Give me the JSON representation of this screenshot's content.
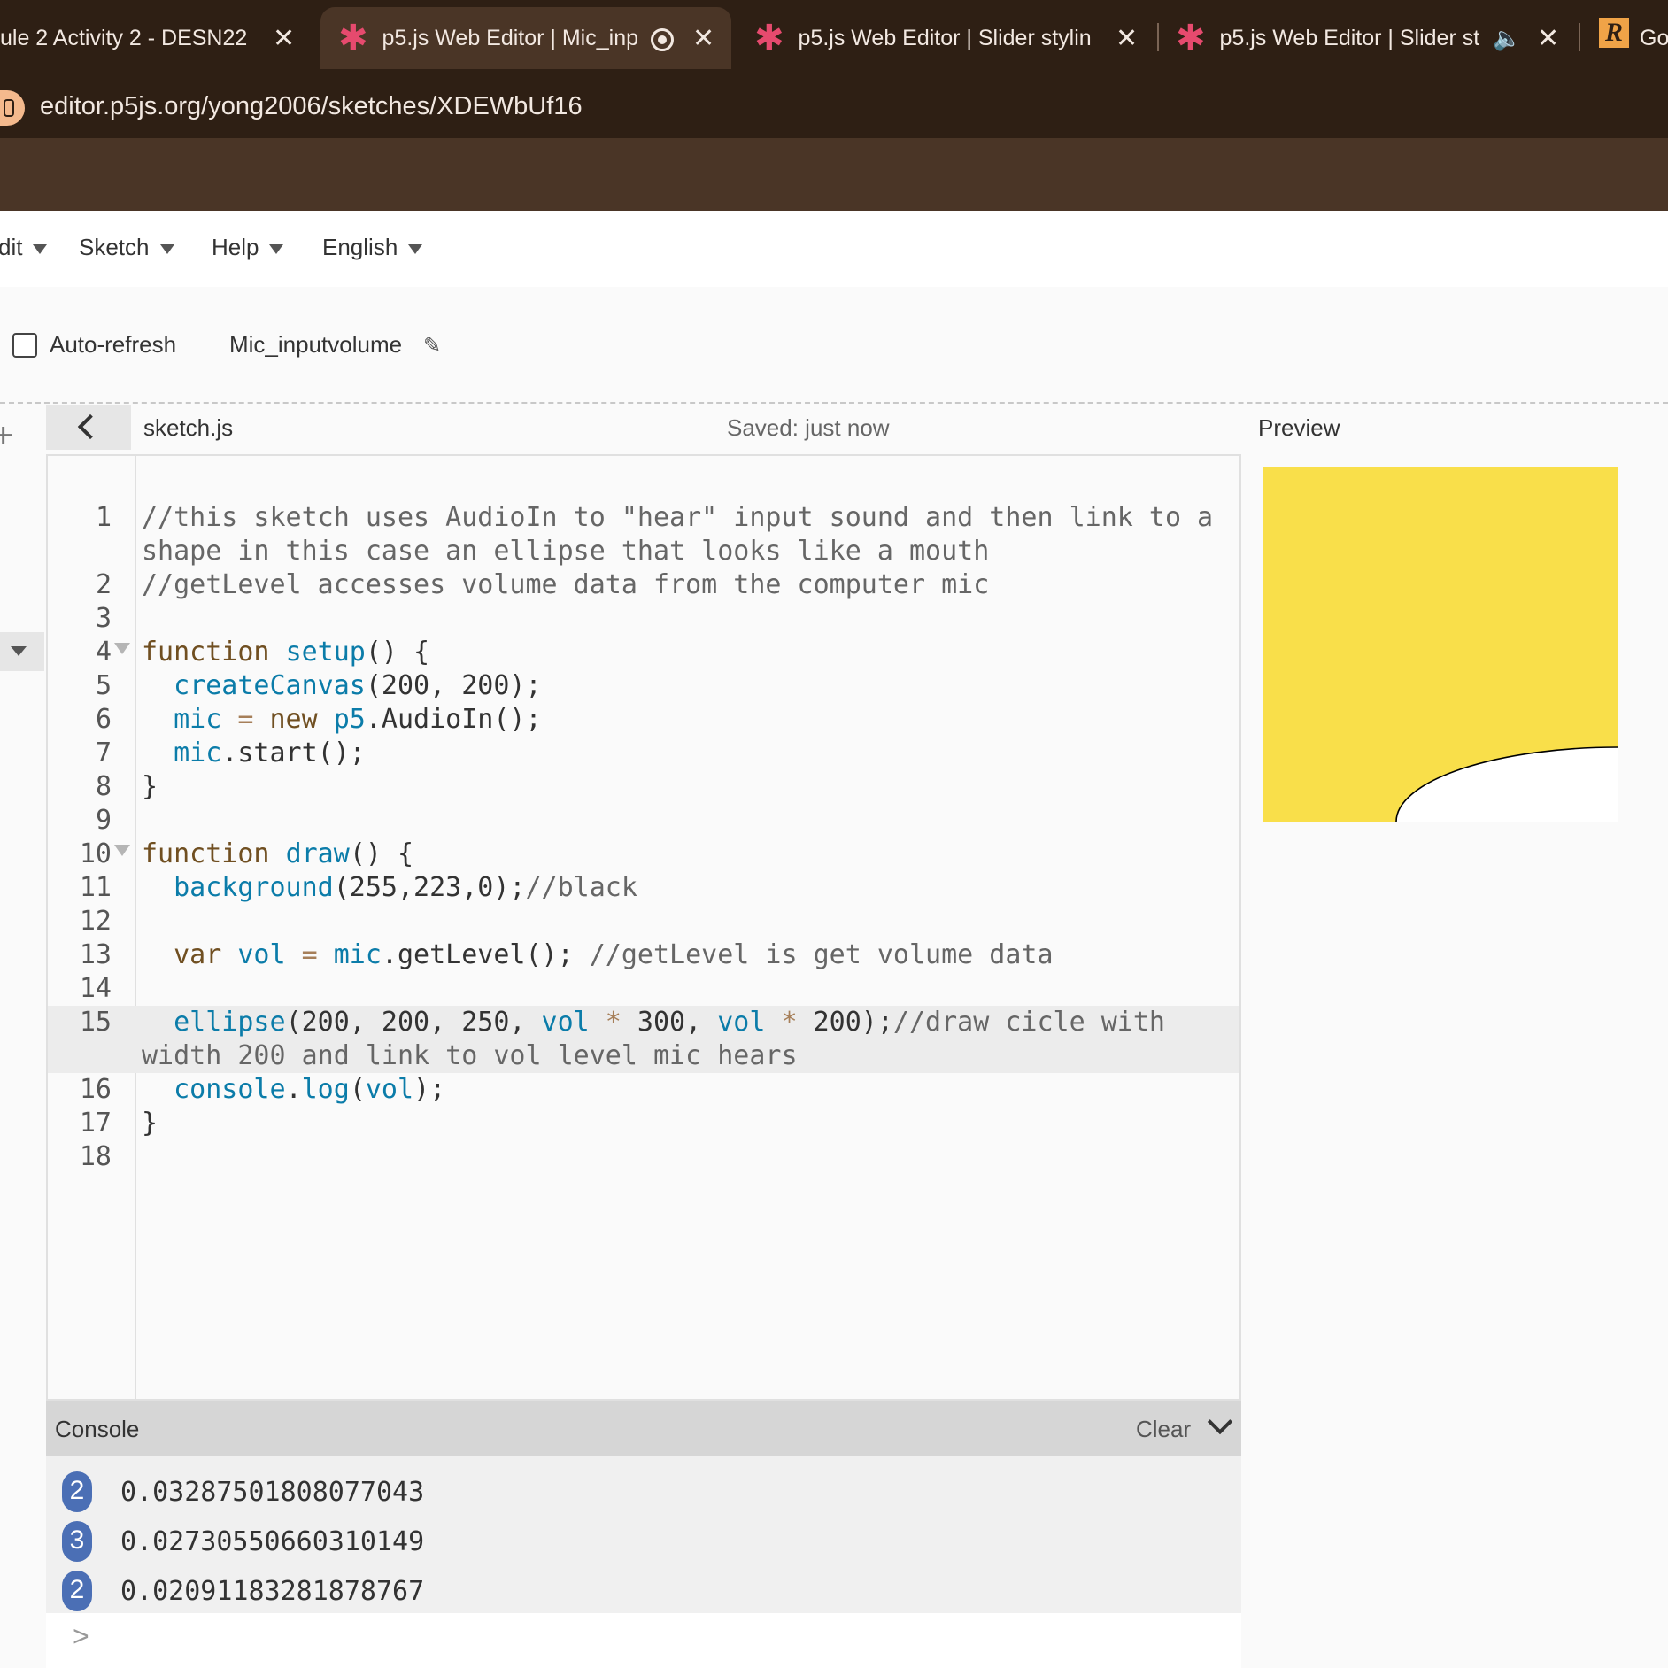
{
  "browser": {
    "tabs": [
      {
        "title": "ule 2 Activity 2 - DESN22"
      },
      {
        "title": "p5.js Web Editor | Mic_inp"
      },
      {
        "title": "p5.js Web Editor | Slider stylin"
      },
      {
        "title": "p5.js Web Editor | Slider st"
      },
      {
        "title": "Go"
      }
    ],
    "url": "editor.p5js.org/yong2006/sketches/XDEWbUf16"
  },
  "menu": {
    "items": [
      "dit",
      "Sketch",
      "Help",
      "English"
    ]
  },
  "toolbar": {
    "auto_refresh_label": "Auto-refresh",
    "auto_refresh_checked": false,
    "sketch_name": "Mic_inputvolume"
  },
  "editor": {
    "filename": "sketch.js",
    "save_status": "Saved: just now",
    "preview_label": "Preview",
    "highlighted_line": 15,
    "lines": [
      {
        "n": "1",
        "text": "//this sketch uses AudioIn to \"hear\" input sound and then link to a shape in this case an ellipse that looks like a mouth"
      },
      {
        "n": "2",
        "text": "//getLevel accesses volume data from the computer mic"
      },
      {
        "n": "3",
        "text": ""
      },
      {
        "n": "4",
        "text": "function setup() {"
      },
      {
        "n": "5",
        "text": "  createCanvas(200, 200);"
      },
      {
        "n": "6",
        "text": "  mic = new p5.AudioIn();"
      },
      {
        "n": "7",
        "text": "  mic.start();"
      },
      {
        "n": "8",
        "text": "}"
      },
      {
        "n": "9",
        "text": ""
      },
      {
        "n": "10",
        "text": "function draw() {"
      },
      {
        "n": "11",
        "text": "  background(255,223,0);//black"
      },
      {
        "n": "12",
        "text": ""
      },
      {
        "n": "13",
        "text": "  var vol = mic.getLevel(); //getLevel is get volume data"
      },
      {
        "n": "14",
        "text": ""
      },
      {
        "n": "15",
        "text": "  ellipse(200, 200, 250, vol * 300, vol * 200);//draw cicle with width 200 and link to vol level mic hears"
      },
      {
        "n": "16",
        "text": "  console.log(vol);"
      },
      {
        "n": "17",
        "text": "}"
      },
      {
        "n": "18",
        "text": ""
      }
    ]
  },
  "console": {
    "title": "Console",
    "clear_label": "Clear",
    "entries": [
      {
        "count": "2",
        "value": "0.03287501808077043"
      },
      {
        "count": "3",
        "value": "0.02730550660310149"
      },
      {
        "count": "2",
        "value": "0.02091183281878767"
      }
    ],
    "prompt": ">"
  },
  "preview": {
    "background": "#f9df4a",
    "ellipse_fill": "#ffffff",
    "ellipse_stroke": "#000000"
  }
}
